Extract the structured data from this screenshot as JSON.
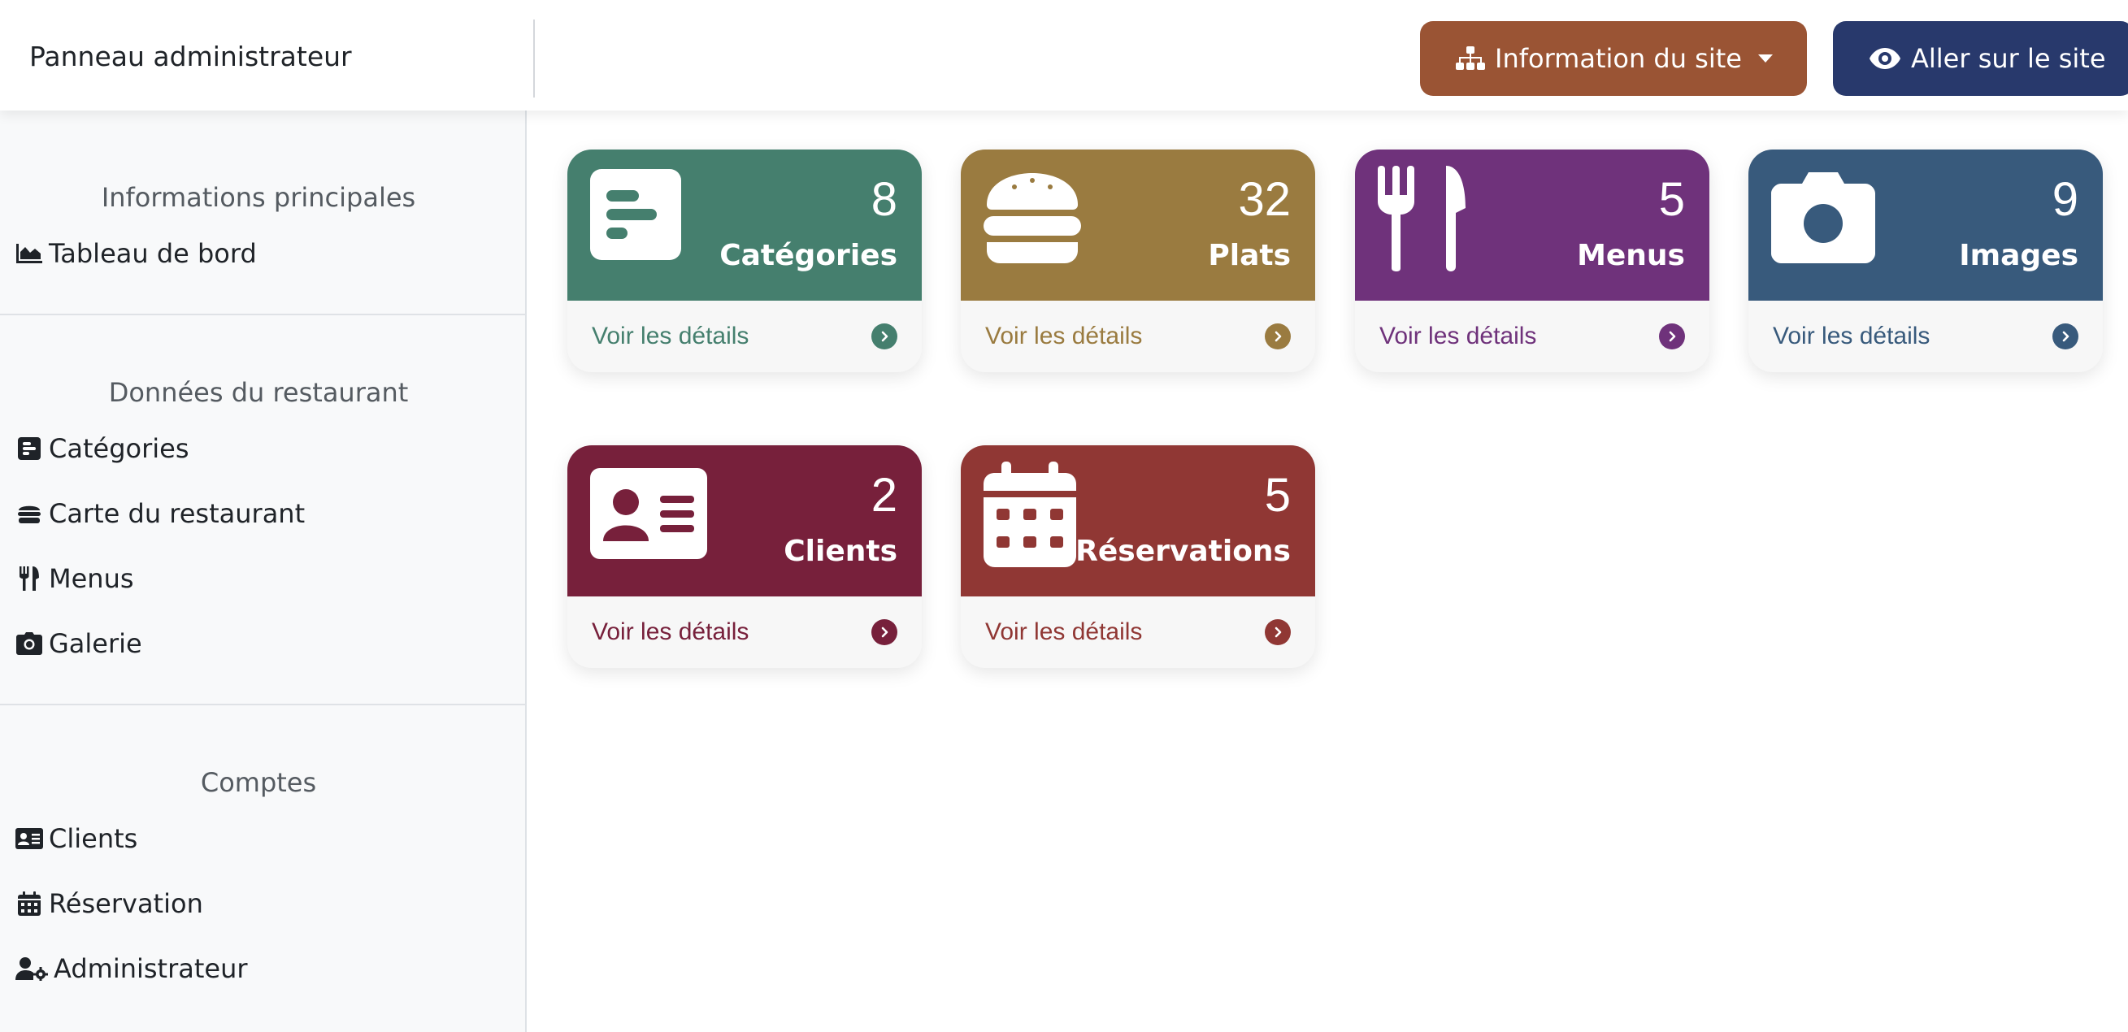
{
  "header": {
    "brand": "Panneau administrateur",
    "info_button": {
      "label": "Information du site",
      "icon": "sitemap-icon"
    },
    "site_button": {
      "label": "Aller sur le site",
      "icon": "eye-icon"
    }
  },
  "sidebar": {
    "sections": [
      {
        "title": "Informations principales",
        "items": [
          {
            "label": "Tableau de bord",
            "icon": "chart-area-icon"
          }
        ]
      },
      {
        "title": "Données du restaurant",
        "items": [
          {
            "label": "Catégories",
            "icon": "list-icon"
          },
          {
            "label": "Carte du restaurant",
            "icon": "burger-icon"
          },
          {
            "label": "Menus",
            "icon": "utensils-icon"
          },
          {
            "label": "Galerie",
            "icon": "camera-icon"
          }
        ]
      },
      {
        "title": "Comptes",
        "items": [
          {
            "label": "Clients",
            "icon": "id-card-icon"
          },
          {
            "label": "Réservation",
            "icon": "calendar-icon"
          },
          {
            "label": "Administrateur",
            "icon": "user-cog-icon"
          }
        ]
      }
    ]
  },
  "cards": [
    {
      "count": "8",
      "label": "Catégories",
      "link": "Voir les détails",
      "color": "#457f6e",
      "icon": "list-icon"
    },
    {
      "count": "32",
      "label": "Plats",
      "link": "Voir les détails",
      "color": "#9a7b40",
      "icon": "burger-icon"
    },
    {
      "count": "5",
      "label": "Menus",
      "link": "Voir les détails",
      "color": "#6f327b",
      "icon": "utensils-icon"
    },
    {
      "count": "9",
      "label": "Images",
      "link": "Voir les détails",
      "color": "#385a7c",
      "icon": "camera-icon"
    },
    {
      "count": "2",
      "label": "Clients",
      "link": "Voir les détails",
      "color": "#77203b",
      "icon": "id-card-icon"
    },
    {
      "count": "5",
      "label": "Réservations",
      "link": "Voir les détails",
      "color": "#903734",
      "icon": "calendar-icon"
    }
  ]
}
